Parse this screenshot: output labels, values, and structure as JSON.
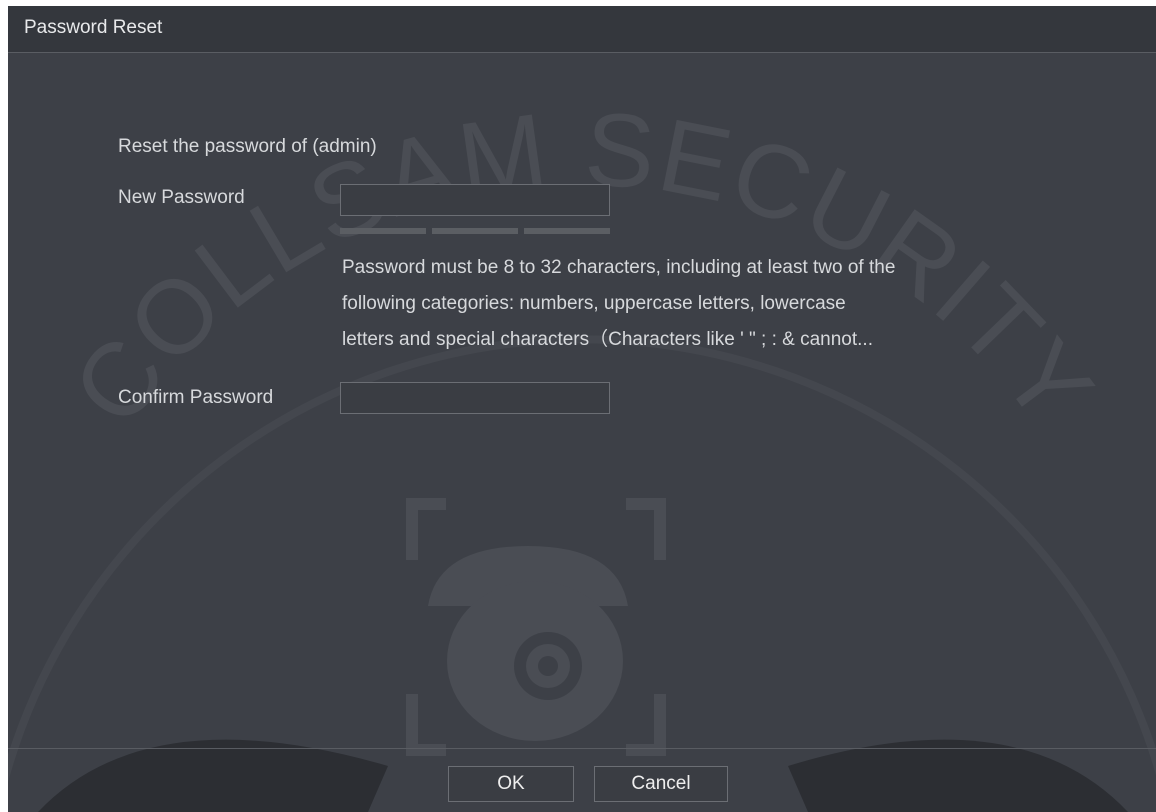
{
  "dialog": {
    "title": "Password Reset"
  },
  "form": {
    "reset_text": "Reset the password of (admin)",
    "new_password_label": "New Password",
    "new_password_value": "",
    "hint_lines": [
      "Password must be 8 to 32 characters, including at least two of the",
      " following categories: numbers, uppercase letters, lowercase",
      "letters and special characters（Characters like ' \" ; : & cannot..."
    ],
    "confirm_password_label": "Confirm Password",
    "confirm_password_value": ""
  },
  "buttons": {
    "ok_label": "OK",
    "cancel_label": "Cancel"
  },
  "watermark": {
    "text": "COLLSAM SECURITY",
    "icon": "dome-camera-icon"
  },
  "colors": {
    "dialog_background": "#3d4047",
    "titlebar_background": "#34373d",
    "text": "#d7d9dc",
    "border": "#6b6e74"
  }
}
